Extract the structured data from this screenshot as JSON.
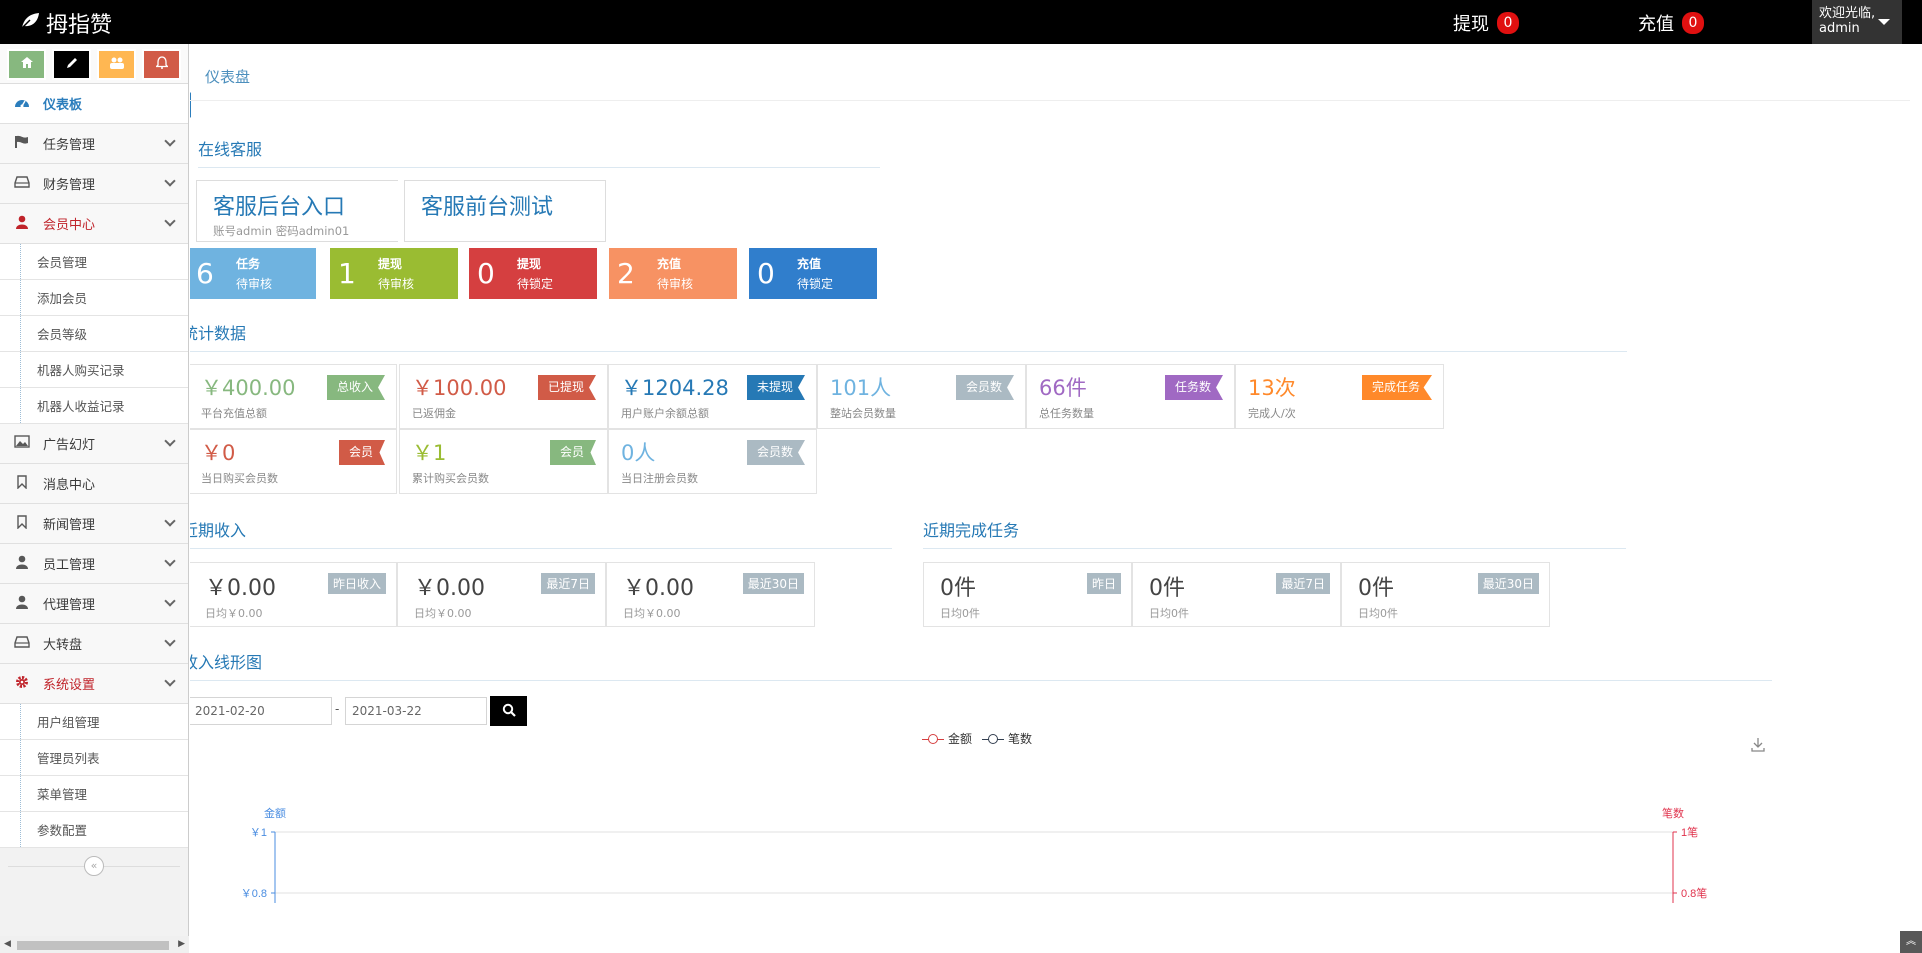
{
  "header": {
    "brand": "拇指赞",
    "withdraw_label": "提现",
    "withdraw_count": "0",
    "recharge_label": "充值",
    "recharge_count": "0",
    "welcome": "欢迎光临,",
    "username": "admin"
  },
  "shortcuts": [
    {
      "icon": "home-icon",
      "color": "#87b87f"
    },
    {
      "icon": "pencil-icon",
      "color": "#000000"
    },
    {
      "icon": "users-icon",
      "color": "#ffb752"
    },
    {
      "icon": "bell-icon",
      "color": "#d15b47"
    }
  ],
  "sidebar": {
    "items": [
      {
        "label": "仪表板",
        "icon": "dashboard-icon",
        "state": "active"
      },
      {
        "label": "任务管理",
        "icon": "flag-icon",
        "arrow": true
      },
      {
        "label": "财务管理",
        "icon": "hdd-icon",
        "arrow": true
      },
      {
        "label": "会员中心",
        "icon": "user-icon",
        "arrow": true,
        "state": "open",
        "children": [
          "会员管理",
          "添加会员",
          "会员等级",
          "机器人购买记录",
          "机器人收益记录"
        ]
      },
      {
        "label": "广告幻灯",
        "icon": "picture-icon",
        "arrow": true
      },
      {
        "label": "消息中心",
        "icon": "bookmark-icon"
      },
      {
        "label": "新闻管理",
        "icon": "bookmark-icon",
        "arrow": true
      },
      {
        "label": "员工管理",
        "icon": "user-icon",
        "arrow": true
      },
      {
        "label": "代理管理",
        "icon": "user-icon",
        "arrow": true
      },
      {
        "label": "大转盘",
        "icon": "hdd-icon",
        "arrow": true
      },
      {
        "label": "系统设置",
        "icon": "cog-icon",
        "arrow": true,
        "state": "open",
        "children": [
          "用户组管理",
          "管理员列表",
          "菜单管理",
          "参数配置"
        ]
      }
    ]
  },
  "breadcrumb": "仪表盘",
  "online_service": {
    "title": "在线客服",
    "backend": {
      "label": "客服后台入口",
      "note": "账号admin 密码admin01"
    },
    "frontend": {
      "label": "客服前台测试"
    }
  },
  "badges": [
    {
      "num": "6",
      "l1": "任务",
      "l2": "待审核",
      "color": "#6fb3e0"
    },
    {
      "num": "1",
      "l1": "提现",
      "l2": "待审核",
      "color": "#9abc32"
    },
    {
      "num": "0",
      "l1": "提现",
      "l2": "待锁定",
      "color": "#d53f40"
    },
    {
      "num": "2",
      "l1": "充值",
      "l2": "待审核",
      "color": "#f79263"
    },
    {
      "num": "0",
      "l1": "充值",
      "l2": "待锁定",
      "color": "#307ecc"
    }
  ],
  "stats_title": "统计数据",
  "stats": [
    {
      "value": "￥400.00",
      "desc": "平台充值总额",
      "tag": "总收入",
      "color": "#87b87f",
      "tag_color": "#87b87f"
    },
    {
      "value": "￥100.00",
      "desc": "已返佣金",
      "tag": "已提现",
      "color": "#d15b47",
      "tag_color": "#d15b47"
    },
    {
      "value": "￥1204.28",
      "desc": "用户账户余额总额",
      "tag": "未提现",
      "color": "#2679b5",
      "tag_color": "#2679b5"
    },
    {
      "value": "101人",
      "desc": "整站会员数量",
      "tag": "会员数",
      "color": "#6fb3e0",
      "tag_color": "#abbac3"
    },
    {
      "value": "66件",
      "desc": "总任务数量",
      "tag": "任务数",
      "color": "#a069c3",
      "tag_color": "#a069c3"
    },
    {
      "value": "13次",
      "desc": "完成人/次",
      "tag": "完成任务",
      "color": "#ff892a",
      "tag_color": "#ff892a"
    },
    {
      "value": "￥0",
      "desc": "当日购买会员数",
      "tag": "会员",
      "color": "#d15b47",
      "tag_color": "#d15b47"
    },
    {
      "value": "￥1",
      "desc": "累计购买会员数",
      "tag": "会员",
      "color": "#9abc32",
      "tag_color": "#87b87f"
    },
    {
      "value": "0人",
      "desc": "当日注册会员数",
      "tag": "会员数",
      "color": "#6fb3e0",
      "tag_color": "#abbac3"
    }
  ],
  "recent_income": {
    "title": "近期收入",
    "items": [
      {
        "value": "￥0.00",
        "desc": "日均￥0.00",
        "tag": "昨日收入"
      },
      {
        "value": "￥0.00",
        "desc": "日均￥0.00",
        "tag": "最近7日"
      },
      {
        "value": "￥0.00",
        "desc": "日均￥0.00",
        "tag": "最近30日"
      }
    ]
  },
  "recent_tasks": {
    "title": "近期完成任务",
    "items": [
      {
        "value": "0件",
        "desc": "日均0件",
        "tag": "昨日"
      },
      {
        "value": "0件",
        "desc": "日均0件",
        "tag": "最近7日"
      },
      {
        "value": "0件",
        "desc": "日均0件",
        "tag": "最近30日"
      }
    ]
  },
  "line_chart": {
    "title": "收入线形图",
    "date_from": "2021-02-20",
    "date_to": "2021-03-22",
    "separator": "-"
  },
  "chart_data": {
    "type": "line",
    "series": [
      {
        "name": "金额",
        "color": "#d53f40",
        "values": []
      },
      {
        "name": "笔数",
        "color": "#333f50",
        "values": []
      }
    ],
    "y_left": {
      "label": "金额",
      "ticks": [
        "￥1",
        "￥0.8"
      ],
      "color": "#4a8de1"
    },
    "y_right": {
      "label": "笔数",
      "ticks": [
        "1笔",
        "0.8笔"
      ],
      "color": "#e0334d"
    },
    "ylim": [
      0.8,
      1
    ],
    "legend": "top-center"
  }
}
